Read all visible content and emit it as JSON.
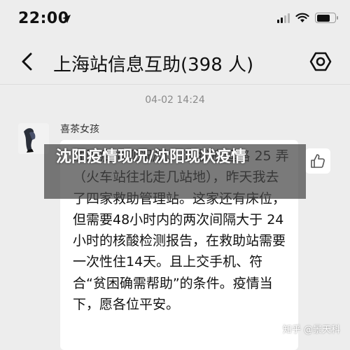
{
  "status_bar": {
    "time": "22:00",
    "signal_bars_active": 2,
    "battery_level": 0.85
  },
  "nav": {
    "title": "上海站信息互助(398 人)"
  },
  "chat": {
    "timestamp": "04-02 14:24",
    "message": {
      "sender": "喜茶女孩",
      "text": "沈阳疫情现况/沈阳现状疫延路 25 弄（火车站往北走几站地），昨天我去了四家救助管理站。这家还有床位，但需要48小时内的两次间隔大于 24 小时的核酸检测报告，在救助站需要一次性住14天。且上交手机、符合“贫困确需帮助”的条件。疫情当下，愿各位平安。"
    }
  },
  "overlay": {
    "title": "沈阳疫情现况/沈阳现状疫情"
  },
  "watermark": {
    "text": "知乎 @景天科"
  },
  "colors": {
    "background": "#ededed",
    "bubble": "#ffffff",
    "overlay": "#464646"
  }
}
